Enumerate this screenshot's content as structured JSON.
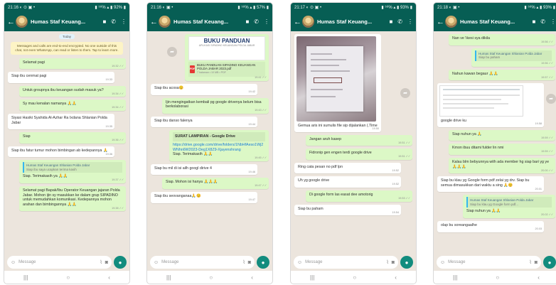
{
  "contact": "Humas Staf Keuang...",
  "composer": {
    "placeholder": "Message"
  },
  "phones": [
    {
      "status_left": "21:16 ◐ ⊙ ▣ •",
      "status_right": "▮ ⁵⁸% ▴ ▮ 92% ▮",
      "date": "Today",
      "notice": "Messages and calls are end-to-end encrypted. No one outside of this chat, not even WhatsApp, can read or listen to them. Tap to learn more.",
      "messages": [
        {
          "dir": "out",
          "text": "Selamat pagi",
          "time": "19.32 ✓✓"
        },
        {
          "dir": "in",
          "text": "Siap ibu cenmat pagi",
          "time": "19.33"
        },
        {
          "dir": "out",
          "text": "Untuk groupnya ibu keuangan sudah masuk ya?",
          "time": "19.34 ✓✓"
        },
        {
          "dir": "out",
          "text": "Sy mau kenalan namanya 🙏🙏",
          "time": "19.34 ✓✓"
        },
        {
          "dir": "in",
          "text": "Siyasi Hasiki Syahida Al-Azhar Ra Ixdana Shlanian Polda Jabar",
          "time": "19.35"
        },
        {
          "dir": "out",
          "text": "Siap",
          "time": "19.36 ✓✓"
        },
        {
          "dir": "in",
          "text": "Siap ibu fatur tumur mohon bimbingan ab kedepannya 🙏",
          "time": "19.36"
        },
        {
          "dir": "out",
          "quote_author": "Humas Staf Keuangan Shlanian Polda Jabar",
          "quote_text": "Siap ibu saya ucapkan terima kasih",
          "text": "Siap. Terimakasih ya 🙏🙏",
          "time": "19.37 ✓✓"
        },
        {
          "dir": "out",
          "text": "Selamat pagi Bapak/Ibu Operator Keuangan jajaran Polda Jabar. Mohon ijin sy masukkan ke dalam grup SIPADINO untuk memudahkan komunikasi. Kedepannya mohon arahan dan bimbingannya 🙏🙏",
          "time": "19.38 ✓✓"
        }
      ]
    },
    {
      "status_left": "21:16 ◐ ▣ •",
      "status_right": "▮ ⁵⁸% ▴ ▮ 57% ▮",
      "doc": {
        "cover_title": "BUKU PANDUAN",
        "cover_sub": "APLIKASI SIPADINO KEUANGAN POLDA JABAR",
        "file_name": "BUKU PANDUAN SIPADINO KEUANGAN POLDA JABAR 2023.pdf",
        "file_meta": "7 halaman • 10 MB • PDF",
        "time": "19.41 ✓✓"
      },
      "messages": [
        {
          "dir": "in",
          "text": "Siap ibu acosa😊",
          "time": "19.42"
        },
        {
          "dir": "out",
          "text": "Ijin mengingatkan kembali pg google drivenya belum bisa berkolaborasi",
          "time": "19.43 ✓✓"
        },
        {
          "dir": "in",
          "text": "Siap ibu danso falenya",
          "time": "19.44"
        },
        {
          "dir": "out",
          "link_title": "SURAT LAMPIRAN - Google Drive",
          "link": "https://drive.google.com/drive/folders/1NbHfAeso1Wj2WNhn6W2023-Deg1X8Z9-Xjayenshrang",
          "text": "Siap. Terimakasih 🙏🙏",
          "time": "19.45 ✓✓"
        },
        {
          "dir": "in",
          "text": "Siap bu mil di isi ailh googl dirive 4",
          "time": "19.46"
        },
        {
          "dir": "out",
          "text": "Siap. Mohon isi hanya 🙏🙏🙏",
          "time": "19.47 ✓✓"
        },
        {
          "dir": "in",
          "text": "Siap ibu seovanganaa🙏😊",
          "time": "19.47"
        }
      ]
    },
    {
      "status_left": "21:17 ◐ ⊙ ▣ •",
      "status_right": "▮ ⁵⁸% ▴ ▮ 93% ▮",
      "photo_caption": "Gemua aris ini sumulis file sip dijalankan (.Time",
      "photo_time": "19.50",
      "messages": [
        {
          "dir": "out",
          "text": "Jangan aruh kasep",
          "time": "19.51 ✓✓"
        },
        {
          "dir": "out",
          "text": "Fidronip gen engen terdi google drive",
          "time": "19.51 ✓✓"
        },
        {
          "dir": "in",
          "text": "Ring cata pesan no pdf lpn",
          "time": "19.52"
        },
        {
          "dir": "in",
          "text": "Uh yg google drive",
          "time": "19.52"
        },
        {
          "dir": "out",
          "text": "Di google form las easat dee amotorig",
          "time": "19.53 ✓✓"
        },
        {
          "dir": "in",
          "text": "Siap bu paham",
          "time": "19.54"
        }
      ]
    },
    {
      "status_left": "21:18 ◐ ▣ •",
      "status_right": "▮ ⁵⁸% ▴ ▮ 93% ▮",
      "messages": [
        {
          "dir": "out",
          "text": "Nan ve 'ikesi sya dikila",
          "time": "19.56 ✓✓"
        },
        {
          "dir": "out",
          "quote_author": "Humas Staf Keuangan Shlanian Polda Jabar",
          "quote_text": "Siap bu paham",
          "text": "",
          "time": "19.56 ✓✓"
        },
        {
          "dir": "out",
          "text": "Nahun kawan begaur 🙏🙏",
          "time": "19.57 ✓✓"
        },
        {
          "dir": "in",
          "screenshot": true,
          "text": "google drive ku",
          "time": "19.58"
        },
        {
          "dir": "out",
          "text": "Siap nuhun ya 🙏",
          "time": "19.59 ✓✓"
        },
        {
          "dir": "out",
          "text": "Kmon ibuu ditami fulder lin nmi",
          "time": "19.59 ✓✓"
        },
        {
          "dir": "out",
          "text": "Kalau blm bebyunnya with ada member hg siap bari yg ye 🙏🙏🙏",
          "time": "20.00 ✓✓"
        },
        {
          "dir": "in",
          "text": "Siap bu klau yg Google form pdf zelai yg drv. Siap bu semua dimasukkan dari waktu a sing 🙏😊",
          "time": "20.01"
        },
        {
          "dir": "out",
          "quote_author": "Humas Staf Keuangan Shlanian Polda Jabar",
          "quote_text": "Siap bu klau yg Google form pdf...",
          "text": "Siap nuhun ya 🙏🙏",
          "time": "20.02 ✓✓"
        },
        {
          "dir": "in",
          "text": "olap bu soreangaalhe",
          "time": "20.03"
        }
      ]
    }
  ]
}
